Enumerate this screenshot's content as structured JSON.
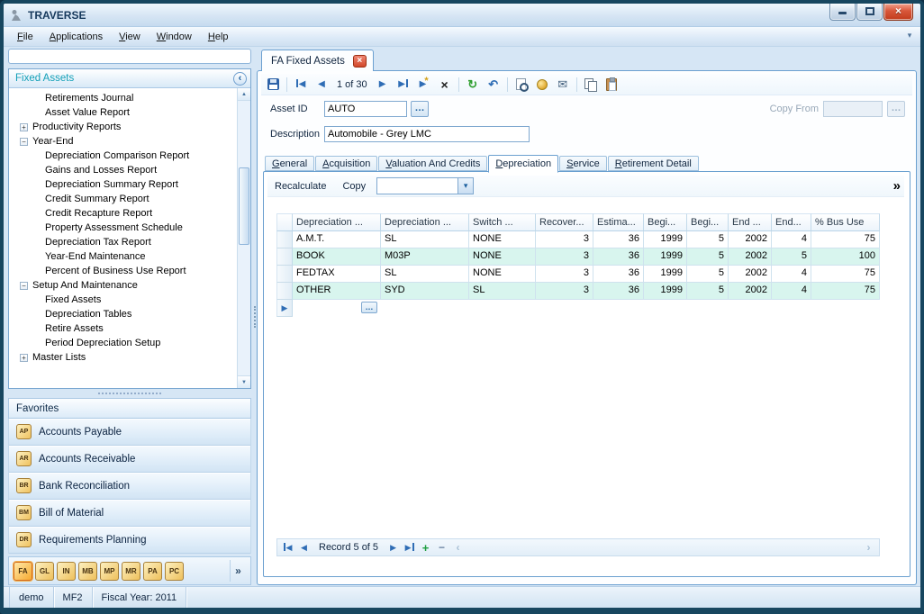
{
  "window": {
    "title": "TRAVERSE",
    "menu": [
      "File",
      "Applications",
      "View",
      "Window",
      "Help"
    ]
  },
  "doc_tab": {
    "label": "FA Fixed Assets"
  },
  "sidebar": {
    "title": "Fixed Assets",
    "tree": [
      {
        "label": "Retirements Journal",
        "level": 1,
        "glyph": ""
      },
      {
        "label": "Asset Value Report",
        "level": 1,
        "glyph": ""
      },
      {
        "label": "Productivity Reports",
        "level": 0,
        "glyph": "+"
      },
      {
        "label": "Year-End",
        "level": 0,
        "glyph": "−"
      },
      {
        "label": "Depreciation Comparison Report",
        "level": 1,
        "glyph": ""
      },
      {
        "label": "Gains and Losses Report",
        "level": 1,
        "glyph": ""
      },
      {
        "label": "Depreciation Summary Report",
        "level": 1,
        "glyph": ""
      },
      {
        "label": "Credit Summary Report",
        "level": 1,
        "glyph": ""
      },
      {
        "label": "Credit Recapture Report",
        "level": 1,
        "glyph": ""
      },
      {
        "label": "Property Assessment Schedule",
        "level": 1,
        "glyph": ""
      },
      {
        "label": "Depreciation Tax Report",
        "level": 1,
        "glyph": ""
      },
      {
        "label": "Year-End Maintenance",
        "level": 1,
        "glyph": ""
      },
      {
        "label": "Percent of Business Use Report",
        "level": 1,
        "glyph": ""
      },
      {
        "label": "Setup And Maintenance",
        "level": 0,
        "glyph": "−"
      },
      {
        "label": "Fixed Assets",
        "level": 1,
        "glyph": ""
      },
      {
        "label": "Depreciation Tables",
        "level": 1,
        "glyph": ""
      },
      {
        "label": "Retire Assets",
        "level": 1,
        "glyph": ""
      },
      {
        "label": "Period Depreciation Setup",
        "level": 1,
        "glyph": ""
      },
      {
        "label": "Master Lists",
        "level": 0,
        "glyph": "+"
      }
    ],
    "favorites_title": "Favorites",
    "favorites": [
      {
        "abbr": "AP",
        "label": "Accounts Payable"
      },
      {
        "abbr": "AR",
        "label": "Accounts Receivable"
      },
      {
        "abbr": "BR",
        "label": "Bank Reconciliation"
      },
      {
        "abbr": "BM",
        "label": "Bill of Material"
      },
      {
        "abbr": "DR",
        "label": "Requirements Planning"
      }
    ],
    "app_icons": [
      {
        "abbr": "FA",
        "active": true
      },
      {
        "abbr": "GL",
        "active": false
      },
      {
        "abbr": "IN",
        "active": false
      },
      {
        "abbr": "MB",
        "active": false
      },
      {
        "abbr": "MP",
        "active": false
      },
      {
        "abbr": "MR",
        "active": false
      },
      {
        "abbr": "PA",
        "active": false
      },
      {
        "abbr": "PC",
        "active": false
      }
    ]
  },
  "toolbar": {
    "record_position": "1 of 30"
  },
  "form": {
    "asset_id_label": "Asset ID",
    "asset_id_value": "AUTO",
    "copy_from_label": "Copy From",
    "description_label": "Description",
    "description_value": "Automobile - Grey LMC"
  },
  "form_tabs": [
    {
      "label": "General",
      "active": false
    },
    {
      "label": "Acquisition",
      "active": false
    },
    {
      "label": "Valuation And Credits",
      "active": false
    },
    {
      "label": "Depreciation",
      "active": true
    },
    {
      "label": "Service",
      "active": false
    },
    {
      "label": "Retirement Detail",
      "active": false
    }
  ],
  "dep_tab": {
    "recalculate_label": "Recalculate",
    "copy_label": "Copy"
  },
  "grid": {
    "columns": [
      "Depreciation ...",
      "Depreciation ...",
      "Switch ...",
      "Recover...",
      "Estima...",
      "Begi...",
      "Begi...",
      "End ...",
      "End...",
      "% Bus Use"
    ],
    "rows": [
      [
        "A.M.T.",
        "SL",
        "NONE",
        "3",
        "36",
        "1999",
        "5",
        "2002",
        "4",
        "75"
      ],
      [
        "BOOK",
        "M03P",
        "NONE",
        "3",
        "36",
        "1999",
        "5",
        "2002",
        "5",
        "100"
      ],
      [
        "FEDTAX",
        "SL",
        "NONE",
        "3",
        "36",
        "1999",
        "5",
        "2002",
        "4",
        "75"
      ],
      [
        "OTHER",
        "SYD",
        "SL",
        "3",
        "36",
        "1999",
        "5",
        "2002",
        "4",
        "75"
      ]
    ]
  },
  "record_nav": {
    "label": "Record 5 of 5"
  },
  "statusbar": [
    "demo",
    "MF2",
    "Fiscal Year: 2011"
  ],
  "icons": {
    "close": "×",
    "delete": "×",
    "prev": "◀",
    "next": "▶",
    "up": "▲",
    "down": "▼",
    "refresh": "↻",
    "undo": "↶",
    "email": "✉",
    "star": "*",
    "plus": "+",
    "minus": "−",
    "chevrons": "»",
    "collapse": "‹",
    "dots": "…",
    "dropdown": "▾",
    "overflow": "▾",
    "nav_left": "‹",
    "nav_right": "›"
  }
}
